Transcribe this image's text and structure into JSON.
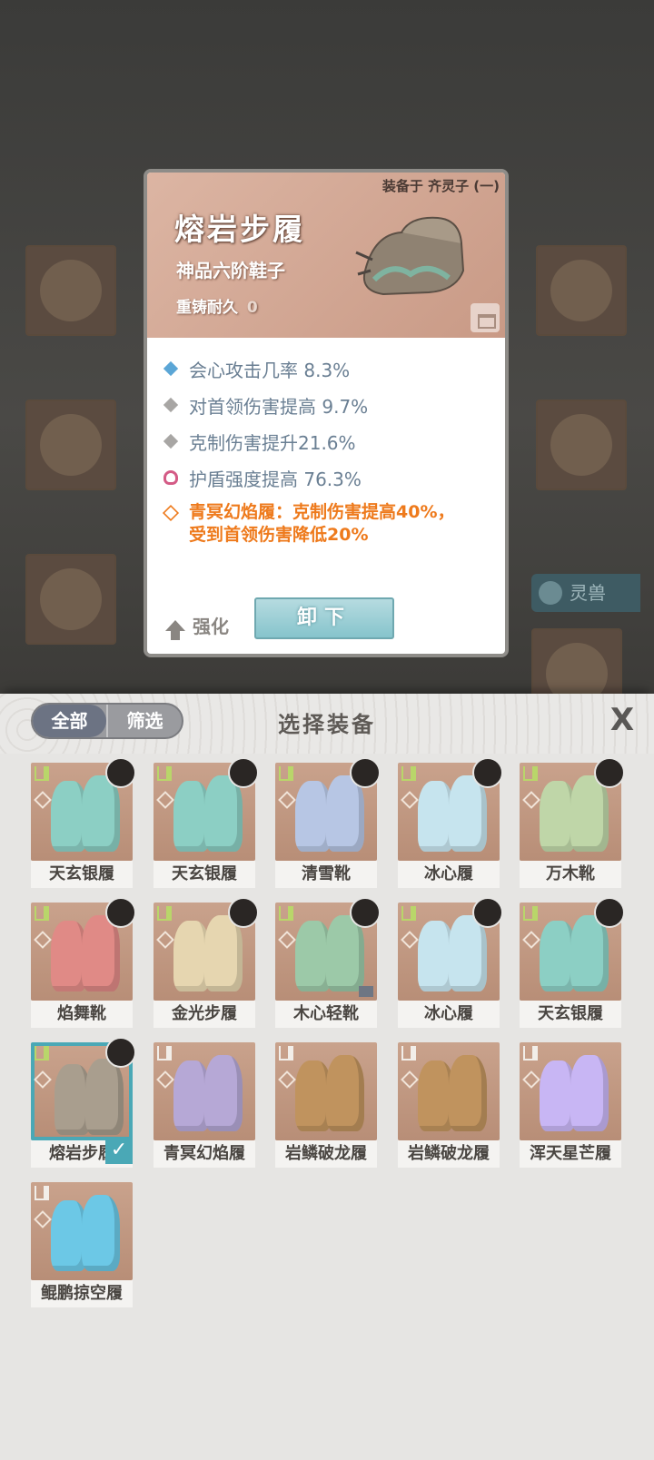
{
  "background": {
    "tab_label": "灵兽"
  },
  "item_card": {
    "equipped_label": "装备于 齐灵子 (一)",
    "name": "熔岩步履",
    "type": "神品六阶鞋子",
    "durability_label": "重铸耐久",
    "durability_value": "0",
    "stats": [
      {
        "icon": "diamond-blue-icon",
        "text": "会心攻击几率 8.3%"
      },
      {
        "icon": "diamond-grey-icon",
        "text": "对首领伤害提高 9.7%"
      },
      {
        "icon": "diamond-grey-icon",
        "text": "克制伤害提升21.6%"
      },
      {
        "icon": "shield-pink-icon",
        "text": "护盾强度提高 76.3%"
      }
    ],
    "set_bonus_line1": "青冥幻焰履：克制伤害提高40%，",
    "set_bonus_line2": "受到首领伤害降低20%",
    "upgrade_label": "强化",
    "unequip_label": "卸下"
  },
  "panel": {
    "filter_all": "全部",
    "filter_select": "筛选",
    "title": "选择装备",
    "close": "X"
  },
  "equipment_list": [
    {
      "name": "天玄银履",
      "color": "#8ccfc4",
      "has_avatar": true
    },
    {
      "name": "天玄银履",
      "color": "#8ccfc4",
      "has_avatar": true
    },
    {
      "name": "清雪靴",
      "color": "#b7c6e4",
      "has_avatar": true
    },
    {
      "name": "冰心履",
      "color": "#c6e4ee",
      "has_avatar": true
    },
    {
      "name": "万木靴",
      "color": "#bfd6a8",
      "has_avatar": true
    },
    {
      "name": "焰舞靴",
      "color": "#e08a86",
      "has_avatar": true
    },
    {
      "name": "金光步履",
      "color": "#e6d6b0",
      "has_avatar": true
    },
    {
      "name": "木心轻靴",
      "color": "#9cc9a8",
      "has_avatar": true,
      "locked": true
    },
    {
      "name": "冰心履",
      "color": "#c6e4ee",
      "has_avatar": true
    },
    {
      "name": "天玄银履",
      "color": "#8ccfc4",
      "has_avatar": true
    },
    {
      "name": "熔岩步履",
      "color": "#a99e8e",
      "has_avatar": true,
      "selected": true
    },
    {
      "name": "青冥幻焰履",
      "color": "#b6a8d6",
      "has_avatar": false
    },
    {
      "name": "岩鳞破龙履",
      "color": "#c0935e",
      "has_avatar": false
    },
    {
      "name": "岩鳞破龙履",
      "color": "#c0935e",
      "has_avatar": false
    },
    {
      "name": "浑天星芒履",
      "color": "#c8b6f4",
      "has_avatar": false
    },
    {
      "name": "鲲鹏掠空履",
      "color": "#6cc8e6",
      "has_avatar": false
    }
  ]
}
